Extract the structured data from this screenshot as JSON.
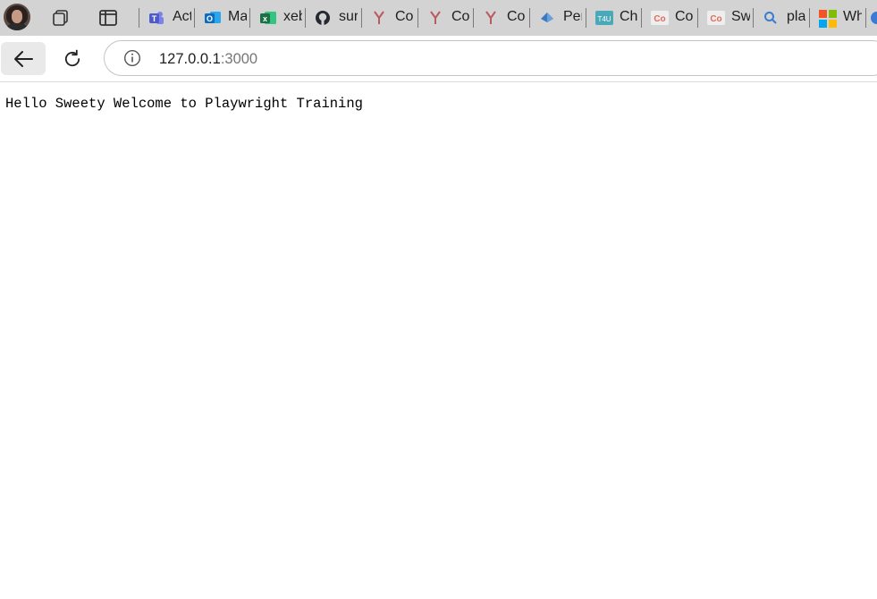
{
  "browser": {
    "tabs": [
      {
        "label": "Act",
        "icon": "teams-icon"
      },
      {
        "label": "Ma",
        "icon": "outlook-icon"
      },
      {
        "label": "xeb",
        "icon": "excel-icon"
      },
      {
        "label": "sur",
        "icon": "github-icon"
      },
      {
        "label": "Co",
        "icon": "y-favicon-icon"
      },
      {
        "label": "Co",
        "icon": "y-favicon-icon"
      },
      {
        "label": "Co",
        "icon": "y-favicon-icon"
      },
      {
        "label": "Per",
        "icon": "azure-icon"
      },
      {
        "label": "Cha",
        "icon": "t4u-icon"
      },
      {
        "label": "Co",
        "icon": "co-favicon-icon"
      },
      {
        "label": "Sw",
        "icon": "co-favicon-icon"
      },
      {
        "label": "pla",
        "icon": "search-icon"
      },
      {
        "label": "Wh",
        "icon": "microsoft-icon"
      }
    ],
    "address": {
      "host": "127.0.0.1",
      "port": ":3000"
    }
  },
  "page": {
    "greeting": "Hello Sweety Welcome to Playwright Training"
  },
  "colors": {
    "tabstrip_bg": "#d3d3d3",
    "teams": "#5059c9",
    "outlook": "#0f6cbd",
    "excel": "#1d7044",
    "github": "#24292f",
    "y_favicon": "#b85a62",
    "co_favicon": "#e06b5a"
  }
}
